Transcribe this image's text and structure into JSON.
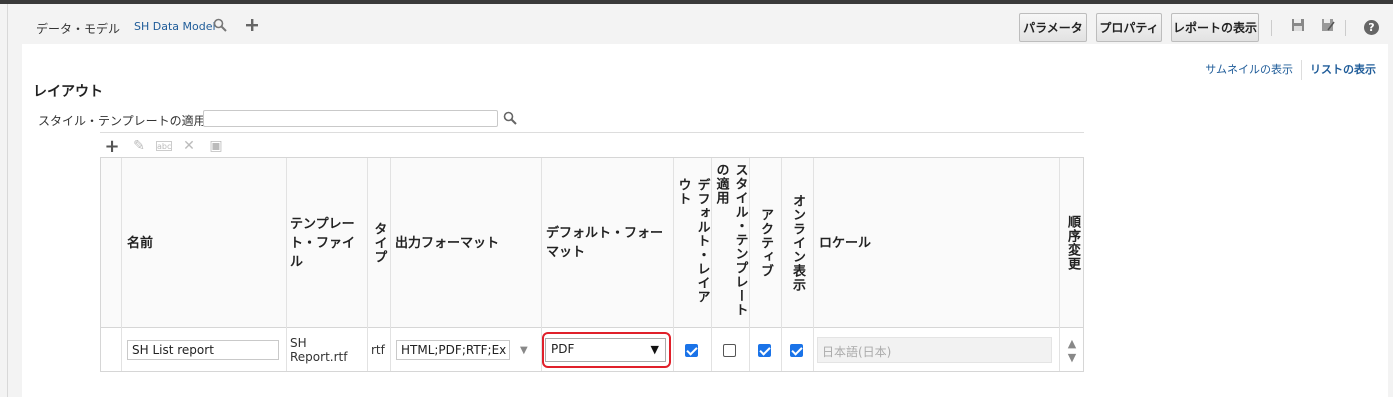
{
  "header": {
    "label": "データ・モデル",
    "data_model": "SH Data Model",
    "buttons": {
      "parameters": "パラメータ",
      "properties": "プロパティ",
      "view_report": "レポートの表示"
    },
    "help": "?"
  },
  "view": {
    "thumbnail": "サムネイルの表示",
    "list": "リストの表示"
  },
  "section": {
    "title": "レイアウト",
    "style_template_label": "スタイル・テンプレートの適用",
    "style_template_value": ""
  },
  "table": {
    "headers": {
      "name": "名前",
      "template_file": "テンプレート・ファイル",
      "type": "タイプ",
      "output_format": "出力フォーマット",
      "default_format": "デフォルト・フォーマット",
      "default_layout": "デフォルト・レイアウト",
      "apply_style": "スタイル・テンプレートの適用",
      "active": "アクティブ",
      "online_view": "オンライン表示",
      "locale": "ロケール",
      "reorder": "順序変更"
    },
    "rows": [
      {
        "name": "SH List report",
        "template_file": "SH Report.rtf",
        "type": "rtf",
        "output_format": "HTML;PDF;RTF;Ex",
        "default_format": "PDF",
        "default_layout": true,
        "apply_style": false,
        "active": true,
        "online_view": true,
        "locale": "日本語(日本)"
      }
    ]
  }
}
